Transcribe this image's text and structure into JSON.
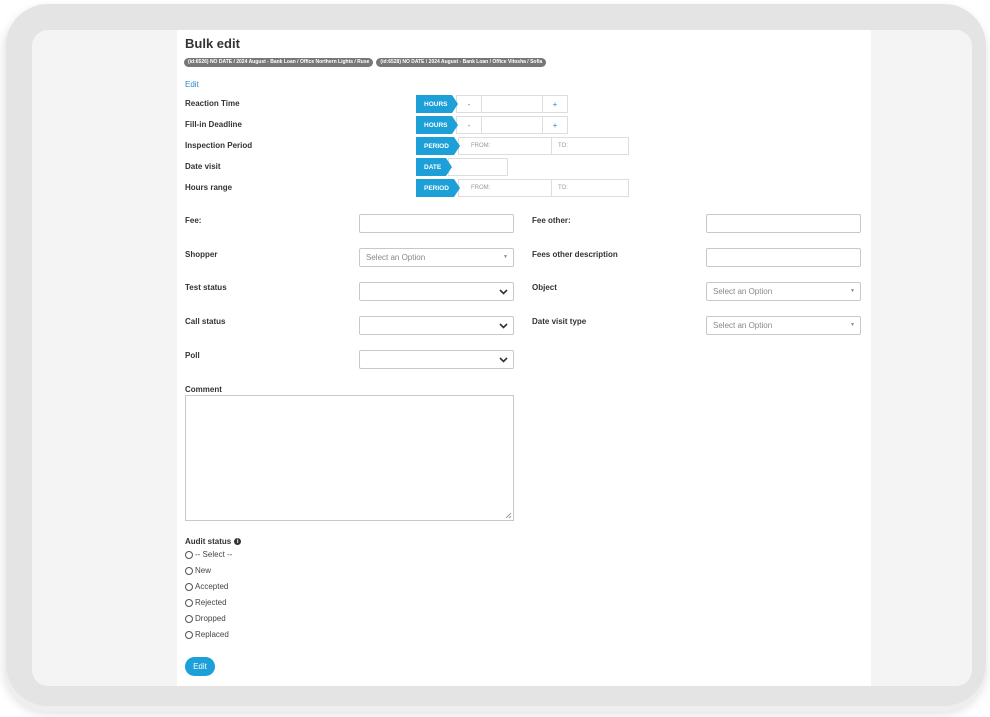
{
  "page": {
    "title": "Bulk edit",
    "edit_link": "Edit"
  },
  "tags": [
    "(id:6526) NO DATE / 2024 August - Bank Loan / Office Northern Lights / Ruse",
    "(id:6528) NO DATE / 2024 August - Bank Loan / Office Vitosha / Sofia"
  ],
  "timing": {
    "reaction_time": {
      "label": "Reaction Time",
      "badge": "HOURS",
      "minus": "-",
      "plus": "+"
    },
    "fill_in_deadline": {
      "label": "Fill-in Deadline",
      "badge": "HOURS",
      "minus": "-",
      "plus": "+"
    },
    "inspection_period": {
      "label": "Inspection Period",
      "badge": "PERIOD",
      "from": "FROM:",
      "to": "TO:"
    },
    "date_visit": {
      "label": "Date visit",
      "badge": "DATE"
    },
    "hours_range": {
      "label": "Hours range",
      "badge": "PERIOD",
      "from": "FROM:",
      "to": "TO:"
    }
  },
  "form": {
    "fee": {
      "label": "Fee:"
    },
    "fee_other": {
      "label": "Fee other:"
    },
    "shopper": {
      "label": "Shopper",
      "placeholder": "Select an Option"
    },
    "fees_other_description": {
      "label": "Fees other description"
    },
    "test_status": {
      "label": "Test status"
    },
    "object": {
      "label": "Object",
      "placeholder": "Select an Option"
    },
    "call_status": {
      "label": "Call status"
    },
    "date_visit_type": {
      "label": "Date visit type",
      "placeholder": "Select an Option"
    },
    "poll": {
      "label": "Poll"
    },
    "comment": {
      "label": "Comment"
    }
  },
  "audit": {
    "label": "Audit status",
    "info_glyph": "i",
    "options": [
      "-- Select --",
      "New",
      "Accepted",
      "Rejected",
      "Dropped",
      "Replaced"
    ]
  },
  "submit": {
    "label": "Edit"
  },
  "colors": {
    "accent": "#1d9fd8",
    "link": "#2a8cd0",
    "tag": "#777777"
  }
}
